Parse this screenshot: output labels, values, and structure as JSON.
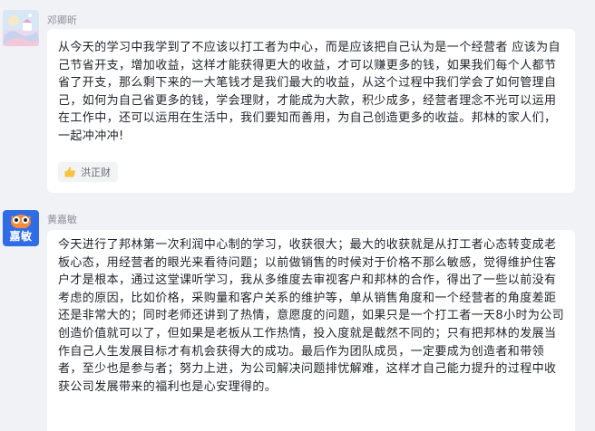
{
  "messages": [
    {
      "sender": "邓卿昕",
      "avatar_icon": "cartoon-scene-avatar",
      "text": "从今天的学习中我学到了不应该以打工者为中心，而是应该把自己认为是一个经营者 应该为自己节省开支，增加收益，这样才能获得更大的收益，才可以赚更多的钱，如果我们每个人都节省了开支，那么剩下来的一大笔钱才是我们最大的收益，从这个过程中我们学会了如何管理自己，如何为自己省更多的钱，学会理财，才能成为大款，积少成多，经营者理念不光可以运用在工作中，还可以运用在生活中，我们要知而善用，为自己创造更多的收益。邦林的家人们，一起冲冲冲!",
      "reaction": {
        "icon": "thumbs-up-icon",
        "names": "洪正财"
      }
    },
    {
      "sender": "黄嘉敏",
      "avatar_label": "嘉敏",
      "avatar_color": "#2f6ce5",
      "text": "今天进行了邦林第一次利润中心制的学习，收获很大；最大的收获就是从打工者心态转变成老板心态，用经营者的眼光来看待问题；以前做销售的时候对于价格不那么敏感，觉得维护住客户才是根本，通过这堂课听学习，我从多维度去审视客户和邦林的合作，得出了一些以前没有考虑的原因，比如价格，采购量和客户关系的维护等，单从销售角度和一个经营者的角度差距还是非常大的；同时老师还讲到了热情，意愿度的问题，如果只是一个打工者一天8小时为公司创造价值就可以了，但如果是老板从工作热情，投入度就是截然不同的；只有把邦林的发展当作自己人生发展目标才有机会获得大的成功。最后作为团队成员，一定要成为创造者和带领者，至少也是参与者；努力上进，为公司解决问题排忧解难，这样才自己能力提升的过程中收获公司发展带来的福利也是心安理得的。"
    }
  ]
}
